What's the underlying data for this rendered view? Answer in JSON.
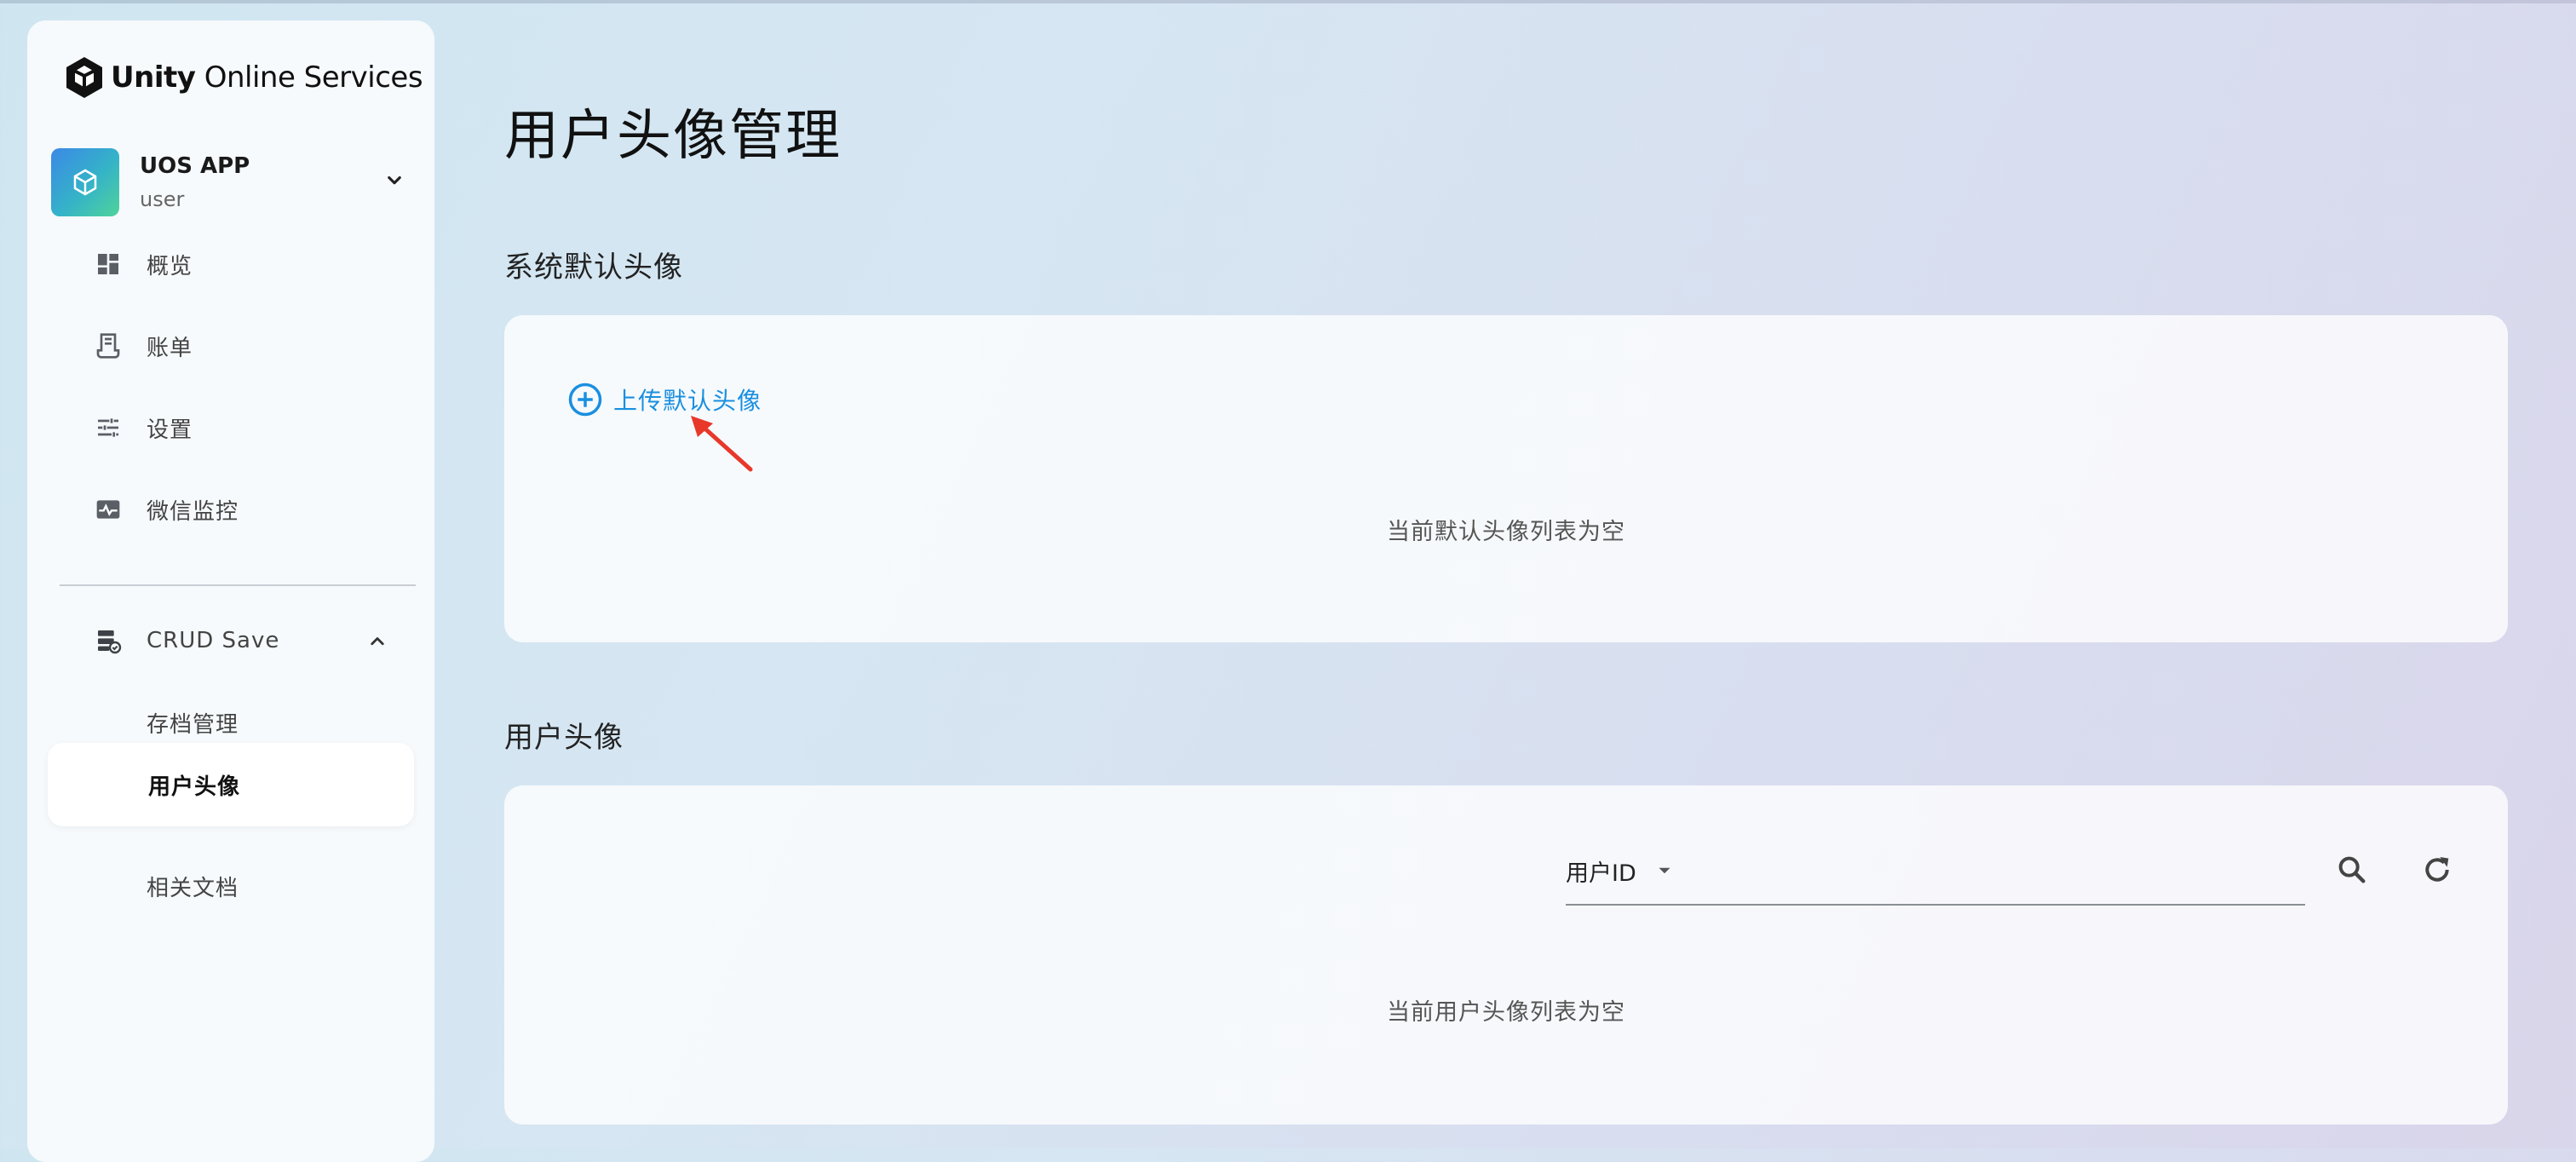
{
  "brand": {
    "bold": "Unity",
    "rest": " Online Services"
  },
  "app": {
    "name": "UOS APP",
    "user": "user"
  },
  "nav": {
    "items": [
      {
        "label": "概览",
        "icon": "dashboard-icon"
      },
      {
        "label": "账单",
        "icon": "receipt-icon"
      },
      {
        "label": "设置",
        "icon": "sliders-icon"
      },
      {
        "label": "微信监控",
        "icon": "monitor-icon"
      }
    ],
    "group": {
      "label": "CRUD Save",
      "icon": "database-icon",
      "expanded": true,
      "children": [
        {
          "label": "存档管理",
          "active": false
        },
        {
          "label": "用户头像",
          "active": true
        },
        {
          "label": "相关文档",
          "active": false
        }
      ]
    }
  },
  "main": {
    "title": "用户头像管理",
    "default_section": {
      "title": "系统默认头像",
      "upload_label": "上传默认头像",
      "empty_text": "当前默认头像列表为空"
    },
    "user_section": {
      "title": "用户头像",
      "filter_field": "用户ID",
      "search_value": "",
      "empty_text": "当前用户头像列表为空"
    }
  },
  "colors": {
    "accent": "#1a8fe0",
    "annotation_arrow": "#e8382a"
  }
}
